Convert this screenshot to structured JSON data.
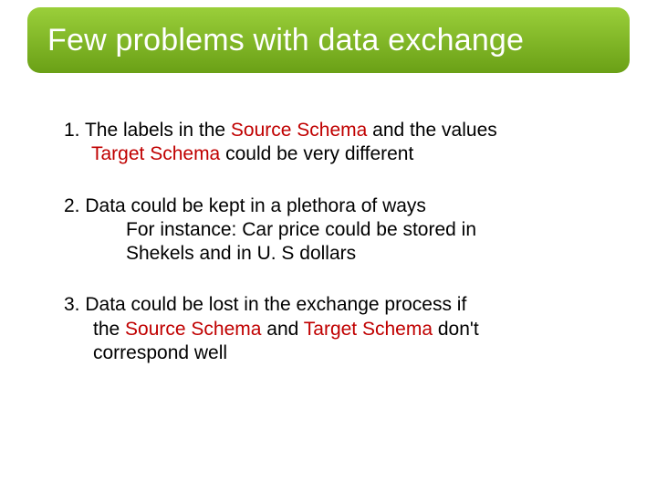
{
  "title": "Few problems with data exchange",
  "items": {
    "one": {
      "num": "1. ",
      "a": "The labels in the ",
      "source": "Source Schema",
      "b": " and the values",
      "target": "Target Schema",
      "c": " could be very different"
    },
    "two": {
      "num": "2. ",
      "a": "Data could be kept in a plethora of ways",
      "b": "For instance: Car price could be stored in",
      "c": "Shekels and in U. S dollars"
    },
    "three": {
      "num": "3.  ",
      "a": "Data could be lost in the exchange process if",
      "b1": "the ",
      "source": "Source Schema",
      "b2": " and ",
      "target": "Target Schema",
      "b3": " don't",
      "c": "correspond well"
    }
  }
}
